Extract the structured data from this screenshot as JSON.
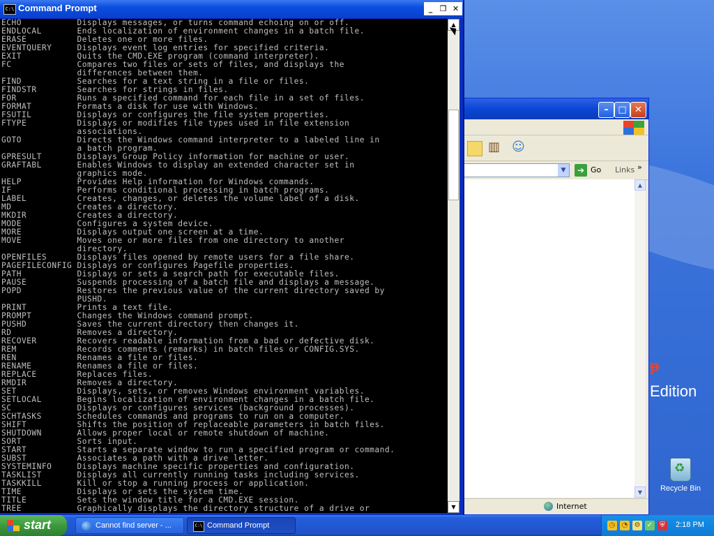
{
  "desktop": {
    "edition_text": "Edition",
    "recycle_bin_label": "Recycle Bin"
  },
  "ie_window": {
    "go_label": "Go",
    "links_label": "Links",
    "links_chevron": "»",
    "status_zone": "Internet"
  },
  "cmd_window": {
    "title": "Command Prompt",
    "lines": [
      "ECHO           Displays messages, or turns command echoing on or off.",
      "ENDLOCAL       Ends localization of environment changes in a batch file.",
      "ERASE          Deletes one or more files.",
      "EVENTQUERY     Displays event log entries for specified criteria.",
      "EXIT           Quits the CMD.EXE program (command interpreter).",
      "FC             Compares two files or sets of files, and displays the",
      "               differences between them.",
      "FIND           Searches for a text string in a file or files.",
      "FINDSTR        Searches for strings in files.",
      "FOR            Runs a specified command for each file in a set of files.",
      "FORMAT         Formats a disk for use with Windows.",
      "FSUTIL         Displays or configures the file system properties.",
      "FTYPE          Displays or modifies file types used in file extension",
      "               associations.",
      "GOTO           Directs the Windows command interpreter to a labeled line in",
      "               a batch program.",
      "GPRESULT       Displays Group Policy information for machine or user.",
      "GRAFTABL       Enables Windows to display an extended character set in",
      "               graphics mode.",
      "HELP           Provides Help information for Windows commands.",
      "IF             Performs conditional processing in batch programs.",
      "LABEL          Creates, changes, or deletes the volume label of a disk.",
      "MD             Creates a directory.",
      "MKDIR          Creates a directory.",
      "MODE           Configures a system device.",
      "MORE           Displays output one screen at a time.",
      "MOVE           Moves one or more files from one directory to another",
      "               directory.",
      "OPENFILES      Displays files opened by remote users for a file share.",
      "PAGEFILECONFIG Displays or configures Pagefile properties.",
      "PATH           Displays or sets a search path for executable files.",
      "PAUSE          Suspends processing of a batch file and displays a message.",
      "POPD           Restores the previous value of the current directory saved by",
      "               PUSHD.",
      "PRINT          Prints a text file.",
      "PROMPT         Changes the Windows command prompt.",
      "PUSHD          Saves the current directory then changes it.",
      "RD             Removes a directory.",
      "RECOVER        Recovers readable information from a bad or defective disk.",
      "REM            Records comments (remarks) in batch files or CONFIG.SYS.",
      "REN            Renames a file or files.",
      "RENAME         Renames a file or files.",
      "REPLACE        Replaces files.",
      "RMDIR          Removes a directory.",
      "SET            Displays, sets, or removes Windows environment variables.",
      "SETLOCAL       Begins localization of environment changes in a batch file.",
      "SC             Displays or configures services (background processes).",
      "SCHTASKS       Schedules commands and programs to run on a computer.",
      "SHIFT          Shifts the position of replaceable parameters in batch files.",
      "SHUTDOWN       Allows proper local or remote shutdown of machine.",
      "SORT           Sorts input.",
      "START          Starts a separate window to run a specified program or command.",
      "SUBST          Associates a path with a drive letter.",
      "SYSTEMINFO     Displays machine specific properties and configuration.",
      "TASKLIST       Displays all currently running tasks including services.",
      "TASKKILL       Kill or stop a running process or application.",
      "TIME           Displays or sets the system time.",
      "TITLE          Sets the window title for a CMD.EXE session.",
      "TREE           Graphically displays the directory structure of a drive or"
    ]
  },
  "taskbar": {
    "start_label": "start",
    "tasks": [
      {
        "label": "Cannot find server - ..."
      },
      {
        "label": "Command Prompt"
      }
    ],
    "clock": "2:18 PM"
  }
}
